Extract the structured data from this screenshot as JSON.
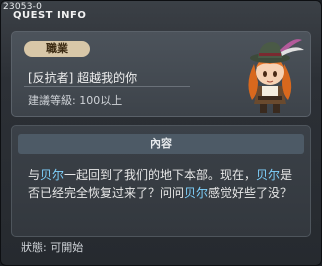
{
  "window": {
    "quest_id": "23053-0",
    "title": "QUEST INFO"
  },
  "quest": {
    "badge_label": "職業",
    "name": "[反抗者] 超越我的你",
    "level": "建議等級: 100以上",
    "portrait": "npc-portrait-girl-with-hat"
  },
  "content": {
    "header": "內容",
    "segments": [
      {
        "text": "与",
        "highlight": false
      },
      {
        "text": "贝尔",
        "highlight": true
      },
      {
        "text": "一起回到了我们的地下本部。现在，",
        "highlight": false
      },
      {
        "text": "贝尔",
        "highlight": true
      },
      {
        "text": "是否已经完全恢复过来了？问问",
        "highlight": false
      },
      {
        "text": "贝尔",
        "highlight": true
      },
      {
        "text": "感觉好些了没？",
        "highlight": false
      }
    ]
  },
  "status": {
    "text": "狀態:  可開始"
  },
  "colors": {
    "highlight": "#7fd3ff",
    "badge_bg": "#d8c7a8"
  }
}
